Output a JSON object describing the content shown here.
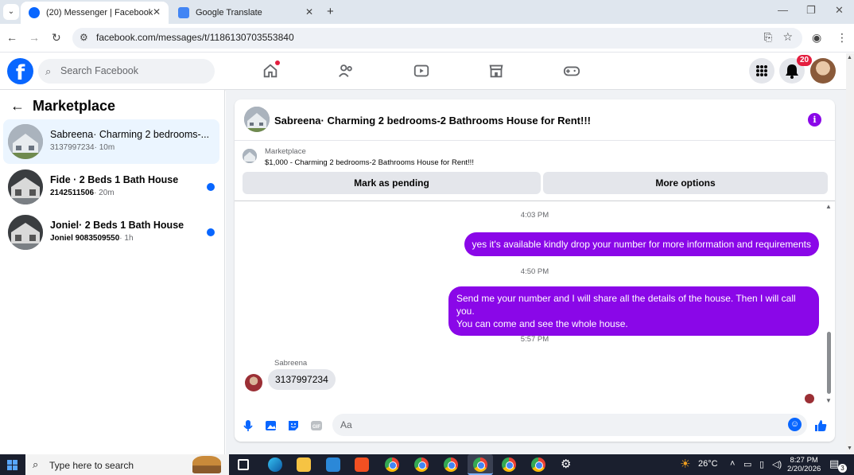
{
  "browser": {
    "tabs": [
      {
        "label": "(20) Messenger | Facebook",
        "active": true
      },
      {
        "label": "Google Translate",
        "active": false
      }
    ],
    "new_tab": "+",
    "url": "facebook.com/messages/t/1186130703553840",
    "window_controls": {
      "minimize": "—",
      "restore": "❐",
      "close": "✕"
    }
  },
  "fb_header": {
    "logo": "f",
    "search_placeholder": "Search Facebook",
    "nav_icons": [
      "home-icon",
      "friends-icon",
      "video-icon",
      "marketplace-icon",
      "gaming-icon"
    ],
    "notifications_count": "20",
    "colors": {
      "brand": "#0866ff",
      "accent": "#8a07e8",
      "badge": "#e41e3f"
    }
  },
  "sidebar": {
    "title": "Marketplace",
    "conversations": [
      {
        "name": "Sabreena· Charming 2 bedrooms-...",
        "phone": "3137997234",
        "time": "· 10m",
        "selected": true,
        "unread": false
      },
      {
        "name": "Fide · 2 Beds 1 Bath House",
        "phone": "2142511506",
        "time": "· 20m",
        "selected": false,
        "unread": true
      },
      {
        "name": "Joniel· 2 Beds 1 Bath House",
        "phone": "Joniel 9083509550",
        "time": "· 1h",
        "selected": false,
        "unread": true
      }
    ]
  },
  "chat": {
    "title": "Sabreena· Charming 2 bedrooms-2 Bathrooms House for Rent!!!",
    "context": {
      "label": "Marketplace",
      "listing": "$1,000 - Charming 2 bedrooms-2 Bathrooms House for Rent!!!",
      "mark_pending": "Mark as pending",
      "more_options": "More options"
    },
    "messages": {
      "ts1": "4:03 PM",
      "out1": "yes it's available kindly drop your number for more information and requirements",
      "ts2": "4:50 PM",
      "out2_line1": "Send me your number and I will share all the details of the house. Then I will call you.",
      "out2_line2": "You can come and see the whole house.",
      "ts3": "5:57 PM",
      "sender": "Sabreena",
      "in1": "3137997234"
    },
    "composer_placeholder": "Aa"
  },
  "taskbar": {
    "search_placeholder": "Type here to search",
    "weather": "26°C",
    "time": "8:27 PM",
    "date": "2/20/2026",
    "notifications": "3"
  }
}
